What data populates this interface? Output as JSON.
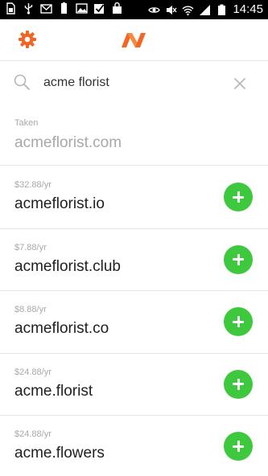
{
  "statusbar": {
    "time": "14:45",
    "left_icons": [
      "sim-card-icon",
      "usb-icon",
      "gmail-icon",
      "battery-app-icon",
      "image-icon",
      "checkbox-icon",
      "shopping-bag-icon"
    ],
    "right_icons": [
      "eye-icon",
      "mute-icon",
      "wifi-icon",
      "signal-icon",
      "battery-icon"
    ]
  },
  "header": {
    "settings_icon": "gear-icon",
    "logo_icon": "namecheap-logo-icon",
    "brand_color": "#f26522"
  },
  "search": {
    "value": "acme florist",
    "icon": "search-icon",
    "clear_icon": "close-icon"
  },
  "taken": {
    "label": "Taken",
    "domain": "acmeflorist.com"
  },
  "results": [
    {
      "price": "$32.88/yr",
      "domain": "acmeflorist.io"
    },
    {
      "price": "$7.88/yr",
      "domain": "acmeflorist.club"
    },
    {
      "price": "$8.88/yr",
      "domain": "acmeflorist.co"
    },
    {
      "price": "$24.88/yr",
      "domain": "acme.florist"
    },
    {
      "price": "$24.88/yr",
      "domain": "acme.flowers"
    }
  ],
  "colors": {
    "add_button": "#3ec83e",
    "muted_text": "#a8a8a8"
  }
}
